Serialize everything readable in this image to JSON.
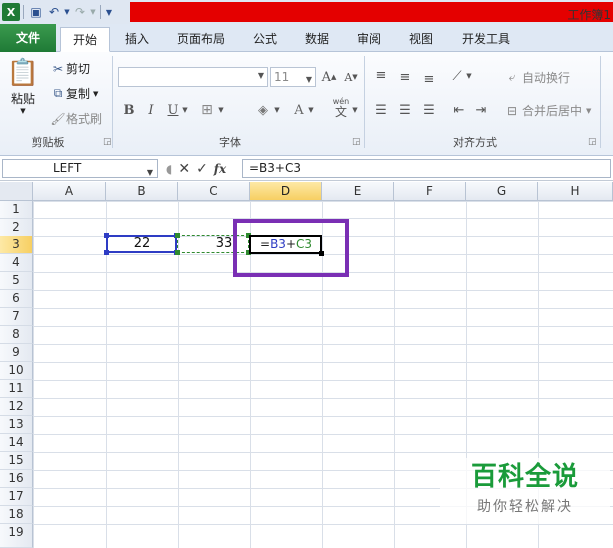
{
  "window": {
    "title": "工作簿1"
  },
  "colors": {
    "file_tab": "#217346",
    "title_red": "#e40000",
    "highlight": "#7a2fb4",
    "ref_b": "#2e3cc4",
    "ref_c": "#2f8a2f",
    "watermark": "#1a9b3a"
  },
  "qat": {
    "icons": [
      "excel-icon",
      "save-icon",
      "undo-icon",
      "redo-icon",
      "customize-qat-icon"
    ]
  },
  "tabs": [
    "文件",
    "开始",
    "插入",
    "页面布局",
    "公式",
    "数据",
    "审阅",
    "视图",
    "开发工具"
  ],
  "clipboard": {
    "paste": "粘贴",
    "cut": "剪切",
    "copy": "复制",
    "format_painter": "格式刷",
    "group_label": "剪贴板"
  },
  "font": {
    "name_value": "",
    "size_value": "11",
    "bold": "B",
    "italic": "I",
    "underline": "U",
    "grow": "A",
    "shrink": "A",
    "wen": "wén",
    "group_label": "字体"
  },
  "alignment": {
    "wrap_text": "自动换行",
    "merge_center": "合并后居中",
    "group_label": "对齐方式"
  },
  "formula_bar": {
    "name_box": "LEFT",
    "fx": "fx",
    "content": "=B3+C3"
  },
  "columns": [
    "A",
    "B",
    "C",
    "D",
    "E",
    "F",
    "G",
    "H"
  ],
  "rows": [
    "1",
    "2",
    "3",
    "4",
    "5",
    "6",
    "7",
    "8",
    "9",
    "10",
    "11",
    "12",
    "13",
    "14",
    "15",
    "16",
    "17",
    "18",
    "19"
  ],
  "cells": {
    "B3": "22",
    "C3": "33",
    "D3_eq": "=",
    "D3_b": "B3",
    "D3_plus": "+",
    "D3_c": "C3"
  },
  "watermark": {
    "title": "百科全说",
    "subtitle": "助你轻松解决"
  }
}
